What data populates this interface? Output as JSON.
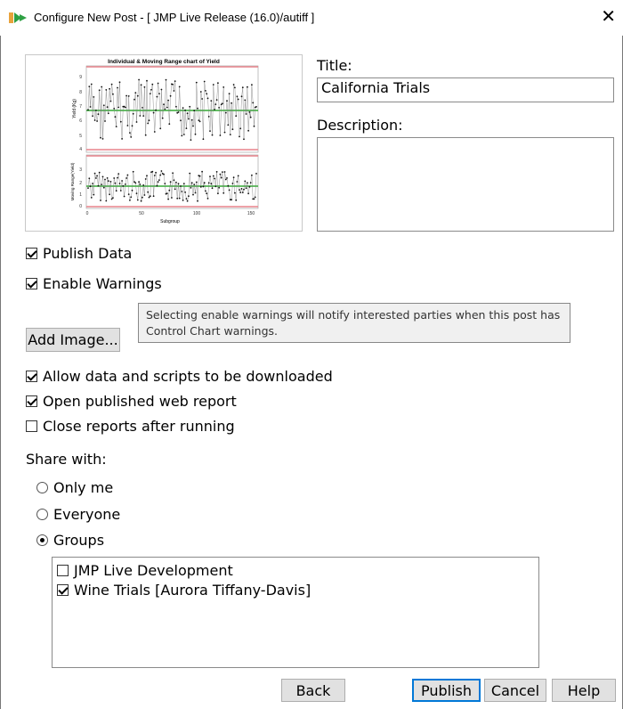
{
  "window": {
    "title": "Configure New Post - [ JMP Live Release (16.0)/autiff ]",
    "close_label": "✕"
  },
  "thumbnail": {
    "title": "Individual & Moving Range chart of Yield",
    "y1label": "Yield (Kg)",
    "y2label": "Moving Range(Yield)",
    "xlabel": "Subgroup",
    "y1ticks": [
      "9",
      "8",
      "7",
      "6",
      "5",
      "4"
    ],
    "y2ticks": [
      "3",
      "2",
      "1",
      "0"
    ],
    "xticks": [
      "0",
      "50",
      "100",
      "150"
    ]
  },
  "form": {
    "title_label": "Title:",
    "title_value": "California Trials",
    "description_label": "Description:",
    "description_value": ""
  },
  "options": {
    "publish_data": {
      "label": "Publish Data",
      "checked": true
    },
    "enable_warnings": {
      "label": "Enable Warnings",
      "checked": true
    },
    "tooltip_line1": "Selecting enable warnings will notify interested parties when this post has",
    "tooltip_line2": "Control Chart warnings.",
    "add_image_label": "Add Image...",
    "allow_download": {
      "label": "Allow data and scripts to be downloaded",
      "checked": true
    },
    "open_report": {
      "label": "Open published web report",
      "checked": true
    },
    "close_reports": {
      "label": "Close reports after running",
      "checked": false
    }
  },
  "share": {
    "label": "Share with:",
    "only_me": "Only me",
    "everyone": "Everyone",
    "groups": "Groups",
    "selected": "Groups",
    "group_items": [
      {
        "label": "JMP Live Development",
        "checked": false
      },
      {
        "label": "Wine Trials [Aurora Tiffany-Davis]",
        "checked": true
      }
    ]
  },
  "buttons": {
    "back": "Back",
    "publish": "Publish",
    "cancel": "Cancel",
    "help": "Help"
  }
}
